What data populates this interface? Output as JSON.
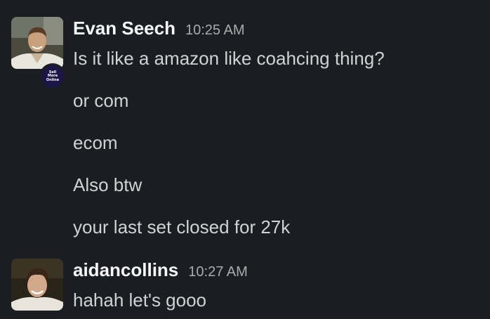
{
  "messages": [
    {
      "sender": "Evan Seech",
      "time": "10:25 AM",
      "avatar": "photo-avatar",
      "badge_lines": [
        "Sell",
        "More",
        "Online"
      ],
      "lines": [
        "Is it like a amazon like coahcing thing?",
        "or com",
        "ecom",
        "Also btw",
        "your last set closed for 27k"
      ]
    },
    {
      "sender": "aidancollins",
      "time": "10:27 AM",
      "avatar": "photo-avatar",
      "lines": [
        "hahah let's gooo"
      ]
    }
  ],
  "colors": {
    "background": "#1a1d21",
    "sender_name": "#f8f8f8",
    "timestamp": "#ababad",
    "message_text": "#d1d2d3",
    "badge_bg": "#1d1545"
  }
}
